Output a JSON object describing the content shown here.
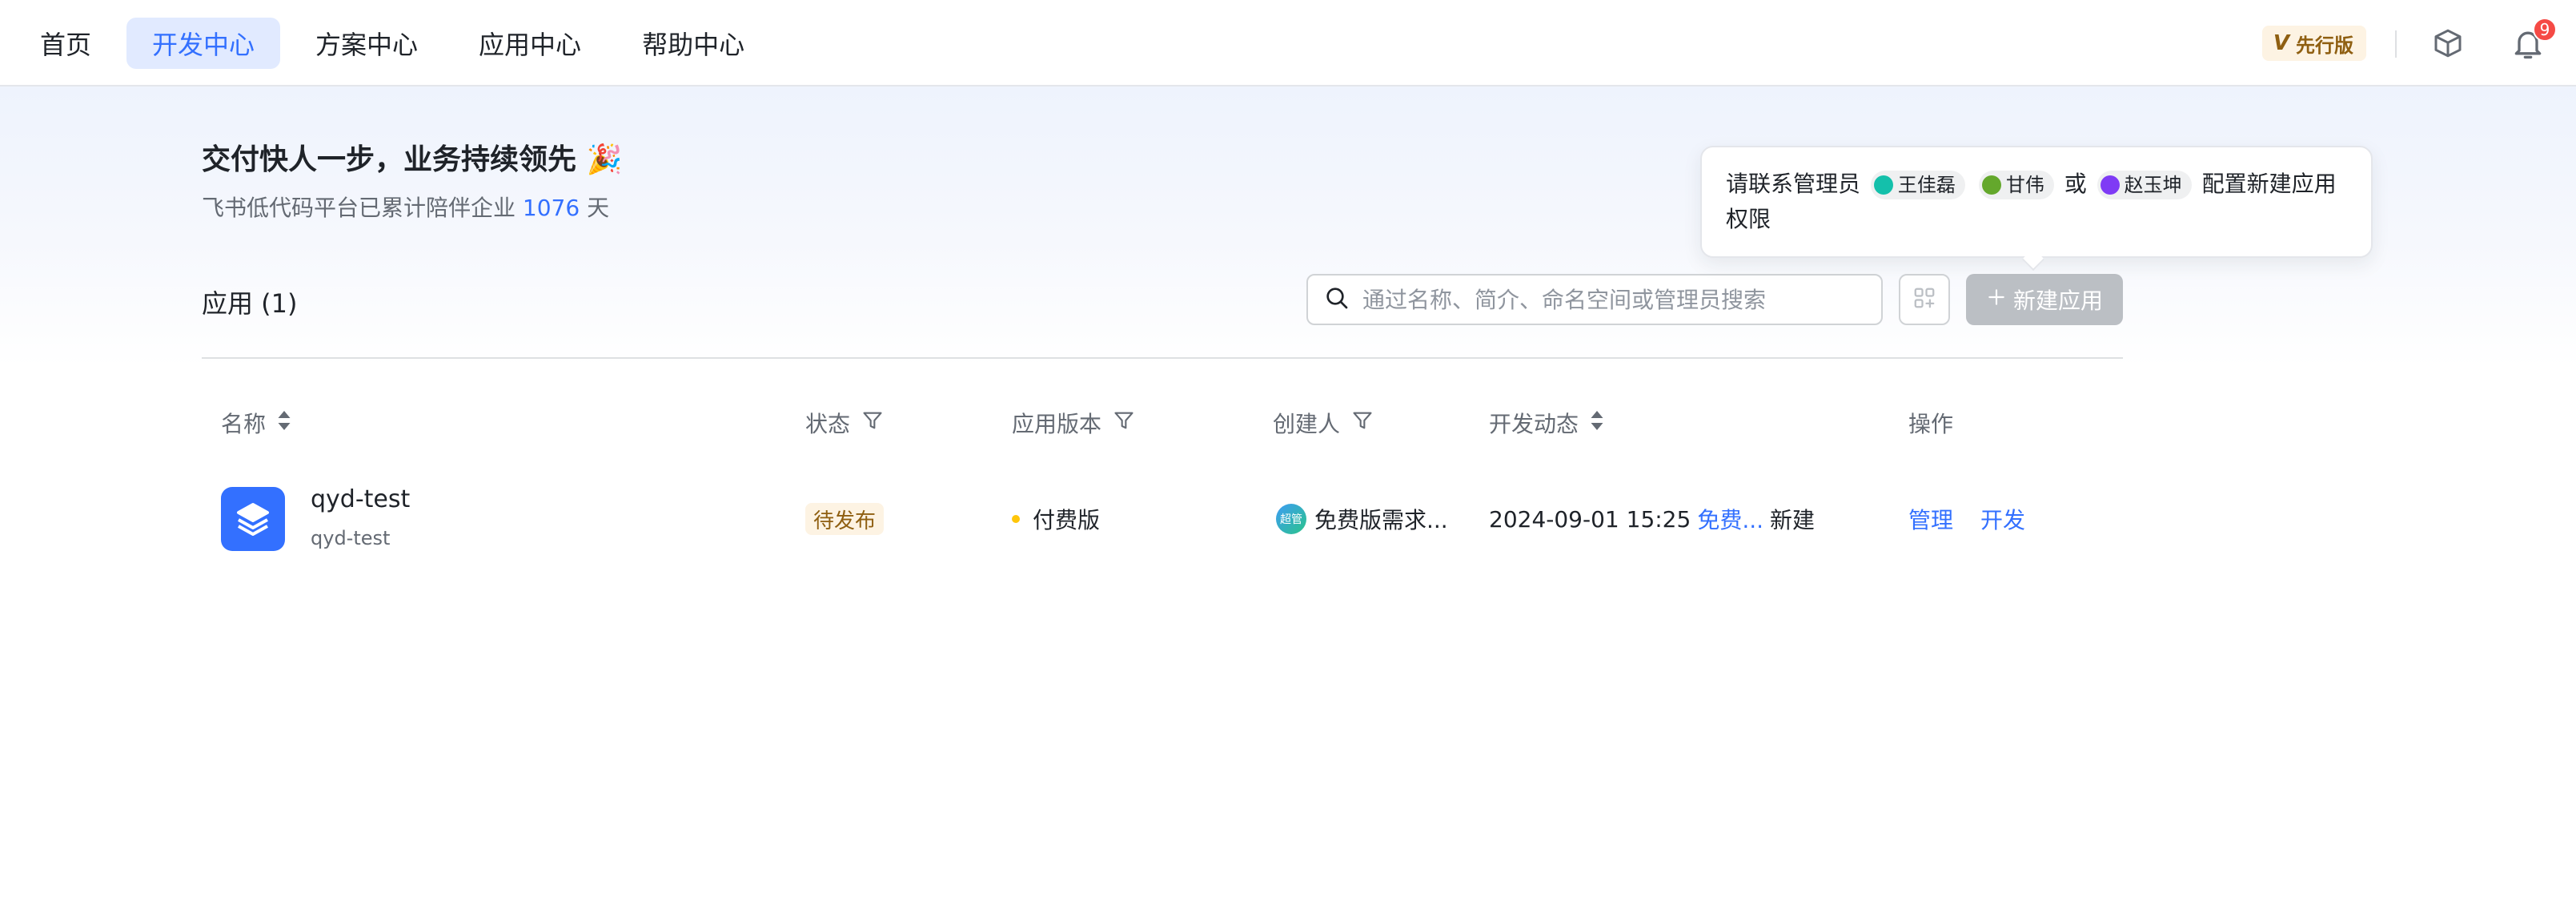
{
  "nav": {
    "items": [
      {
        "label": "首页",
        "active": false
      },
      {
        "label": "开发中心",
        "active": true
      },
      {
        "label": "方案中心",
        "active": false
      },
      {
        "label": "应用中心",
        "active": false
      },
      {
        "label": "帮助中心",
        "active": false
      }
    ]
  },
  "header_right": {
    "edition_label": "先行版",
    "edition_mark": "V",
    "notification_count": "9"
  },
  "hero": {
    "title": "交付快人一步，业务持续领先 🎉",
    "subtitle_prefix": "飞书低代码平台已累计陪伴企业",
    "subtitle_days": "1076",
    "subtitle_suffix": "天"
  },
  "apps": {
    "count_label": "应用 (1)",
    "search_placeholder": "通过名称、简介、命名空间或管理员搜索",
    "new_app_label": "新建应用"
  },
  "tooltip": {
    "prefix": "请联系管理员",
    "admins": [
      "王佳磊",
      "甘伟",
      "赵玉坤"
    ],
    "conjunction": "或",
    "suffix": "配置新建应用权限"
  },
  "table": {
    "headers": {
      "name": "名称",
      "status": "状态",
      "version": "应用版本",
      "creator": "创建人",
      "activity": "开发动态",
      "actions": "操作"
    },
    "rows": [
      {
        "name": "qyd-test",
        "namespace": "qyd-test",
        "status": "待发布",
        "version": "付费版",
        "creator_avatar": "超管",
        "creator": "免费版需求...",
        "activity_time": "2024-09-01 15:25",
        "activity_user": "免费...",
        "activity_action": "新建",
        "action_manage": "管理",
        "action_develop": "开发"
      }
    ]
  },
  "colors": {
    "accent": "#3370ff",
    "status_tag_bg": "#fdf3e3",
    "badge": "#f54a45"
  }
}
